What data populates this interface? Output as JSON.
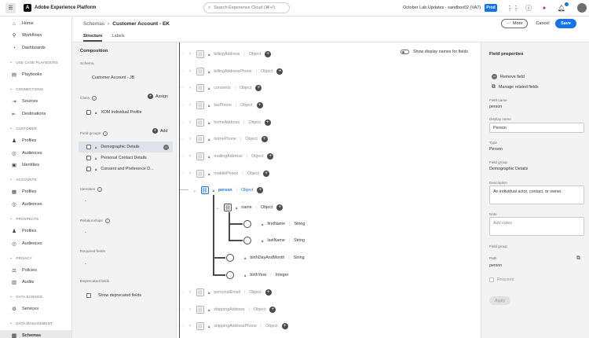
{
  "topbar": {
    "app_title": "Adobe Experience Platform",
    "search_placeholder": "Search Experience Cloud (⌘+/)",
    "org": "October Lab Updates - sandbox02 (VA7)",
    "env_badge": "Prod"
  },
  "nav": {
    "top_items": [
      "Home",
      "Workflows",
      "Dashboards"
    ],
    "sections": [
      {
        "title": "USE CASE PLAYBOOKS",
        "items": [
          "Playbooks"
        ]
      },
      {
        "title": "CONNECTIONS",
        "items": [
          "Sources",
          "Destinations"
        ]
      },
      {
        "title": "CUSTOMER",
        "items": [
          "Profiles",
          "Audiences",
          "Identities"
        ]
      },
      {
        "title": "ACCOUNTS",
        "items": [
          "Profiles",
          "Audiences"
        ]
      },
      {
        "title": "PROSPECTS",
        "items": [
          "Profiles",
          "Audiences"
        ]
      },
      {
        "title": "PRIVACY",
        "items": [
          "Policies",
          "Audits"
        ]
      },
      {
        "title": "DATA SCIENCE",
        "items": [
          "Services"
        ]
      },
      {
        "title": "DATA MANAGEMENT",
        "items": [
          "Schemas"
        ]
      }
    ]
  },
  "header": {
    "breadcrumb_root": "Schemas",
    "breadcrumb_current": "Customer Account - EK",
    "tabs": [
      "Structure",
      "Labels"
    ],
    "more_label": "More",
    "cancel_label": "Cancel",
    "save_label": "Save"
  },
  "composition": {
    "title": "Composition",
    "schema_label": "Schema",
    "schema_value": "Customer Account - JB",
    "class_label": "Class",
    "assign_label": "Assign",
    "class_value": "XDM Individual Profile",
    "field_groups_label": "Field groups",
    "add_label": "Add",
    "field_groups": [
      "Demographic Details",
      "Personal Contact Details",
      "Consent and Preference D..."
    ],
    "identities_label": "Identities",
    "identities_value": "-",
    "relationships_label": "Relationships",
    "relationships_value": "-",
    "required_label": "Required fields",
    "required_value": "-",
    "deprecated_label": "Deprecated fields",
    "show_deprecated": "Show deprecated fields"
  },
  "canvas": {
    "toggle_label": "Show display names for fields",
    "fields": [
      {
        "name": "billingAddress",
        "type": "Object"
      },
      {
        "name": "billingAddressPhone",
        "type": "Object"
      },
      {
        "name": "consents",
        "type": "Object"
      },
      {
        "name": "faxPhone",
        "type": "Object"
      },
      {
        "name": "homeAddress",
        "type": "Object"
      },
      {
        "name": "homePhone",
        "type": "Object"
      },
      {
        "name": "mailingAddress",
        "type": "Object"
      },
      {
        "name": "mobilePhone",
        "type": "Object"
      },
      {
        "name": "person",
        "type": "Object"
      },
      {
        "name": "name",
        "type": "Object"
      },
      {
        "name": "firstName",
        "type": "String"
      },
      {
        "name": "lastName",
        "type": "String"
      },
      {
        "name": "birthDayAndMonth",
        "type": "String"
      },
      {
        "name": "birthYear",
        "type": "Integer"
      },
      {
        "name": "personalEmail",
        "type": "Object"
      },
      {
        "name": "shippingAddress",
        "type": "Object"
      },
      {
        "name": "shippingAddressPhone",
        "type": "Object"
      }
    ]
  },
  "properties": {
    "title": "Field properties",
    "remove_field": "Remove field",
    "manage_related": "Manage related fields",
    "field_name_label": "Field name",
    "field_name": "person",
    "display_name_label": "Display name",
    "display_name": "Person",
    "type_label": "Type",
    "type": "Person",
    "field_group_label": "Field group",
    "field_group": "Demographic Details",
    "description_label": "Description",
    "description": "An individual actor, contact, or owner.",
    "note_label": "Note",
    "note_placeholder": "Add notes",
    "field_group2_label": "Field group",
    "path_label": "Path",
    "path": "person",
    "required_label": "Required",
    "apply_label": "Apply"
  },
  "colors": {
    "accent": "#1473e6",
    "save": "#1473e6"
  }
}
